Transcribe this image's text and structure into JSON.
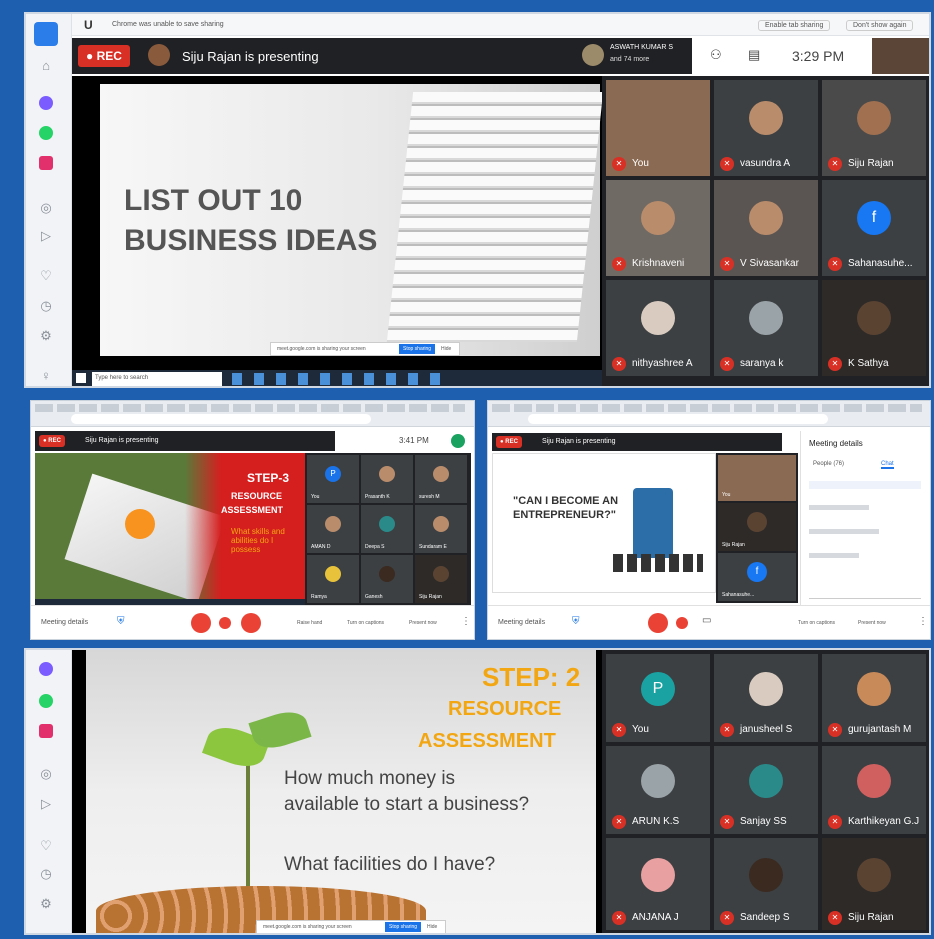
{
  "top_panel": {
    "browser_notice": "Chrome was unable to save sharing",
    "browser_btn1": "Enable tab sharing",
    "browser_btn2": "Don't show again",
    "rec_label": "REC",
    "presenter_text": "Siju Rajan is presenting",
    "others_name": "ASWATH KUMAR S",
    "others_count": "and 74 more",
    "time": "3:29 PM",
    "slide_title_line1": "LIST OUT 10",
    "slide_title_line2": "BUSINESS IDEAS",
    "stop_sharing": "Stop sharing",
    "hide": "Hide",
    "sharing_notice": "meet.google.com is sharing your screen",
    "search_placeholder": "Type here to search",
    "participants": [
      "You",
      "vasundra A",
      "Siju Rajan",
      "Krishnaveni",
      "V Sivasankar",
      "Sahanasuhe...",
      "nithyashree A",
      "saranya k",
      "K Sathya"
    ]
  },
  "mid_left": {
    "presenter_text": "Siju Rajan is presenting",
    "time": "3:41 PM",
    "slide_heading": "STEP-3",
    "slide_sub1": "RESOURCE",
    "slide_sub2": "ASSESSMENT",
    "slide_body": "What skills and abilities do I possess",
    "meeting_details": "Meeting details",
    "present_now": "Present now",
    "turn_on_captions": "Turn on captions",
    "hand": "Raise hand",
    "tiles": [
      "You",
      "Prasanth K",
      "suresh M",
      "AMAN D",
      "Deepa S",
      "Sundaram E",
      "Ramya",
      "Ganesh",
      "Siju Rajan"
    ]
  },
  "mid_right": {
    "presenter_text": "Siju Rajan is presenting",
    "slide_quote": "\"CAN I BECOME AN ENTREPRENEUR?\"",
    "panel_title": "Meeting details",
    "tab_people": "People (76)",
    "tab_chat": "Chat",
    "meeting_details": "Meeting details",
    "present_now": "Present now",
    "turn_on_captions": "Turn on captions",
    "tiles": [
      "You",
      "Siju Rajan",
      "Sahanasuhe..."
    ]
  },
  "bottom_panel": {
    "slide_heading": "STEP: 2",
    "slide_sub1": "RESOURCE",
    "slide_sub2": "ASSESSMENT",
    "question1_line1": "How much money is",
    "question1_line2": "available to start a business?",
    "question2": "What facilities do I have?",
    "stop_sharing": "Stop sharing",
    "hide": "Hide",
    "sharing_notice": "meet.google.com is sharing your screen",
    "participants": [
      "You",
      "janusheel S",
      "gurujantash M",
      "ARUN K.S",
      "Sanjay SS",
      "Karthikeyan G.J",
      "ANJANA J",
      "Sandeep S",
      "Siju Rajan"
    ]
  },
  "colors": {
    "rec_red": "#d93025",
    "meet_dark": "#202124",
    "accent_orange": "#f2a612",
    "step_red": "#d51f1f"
  }
}
